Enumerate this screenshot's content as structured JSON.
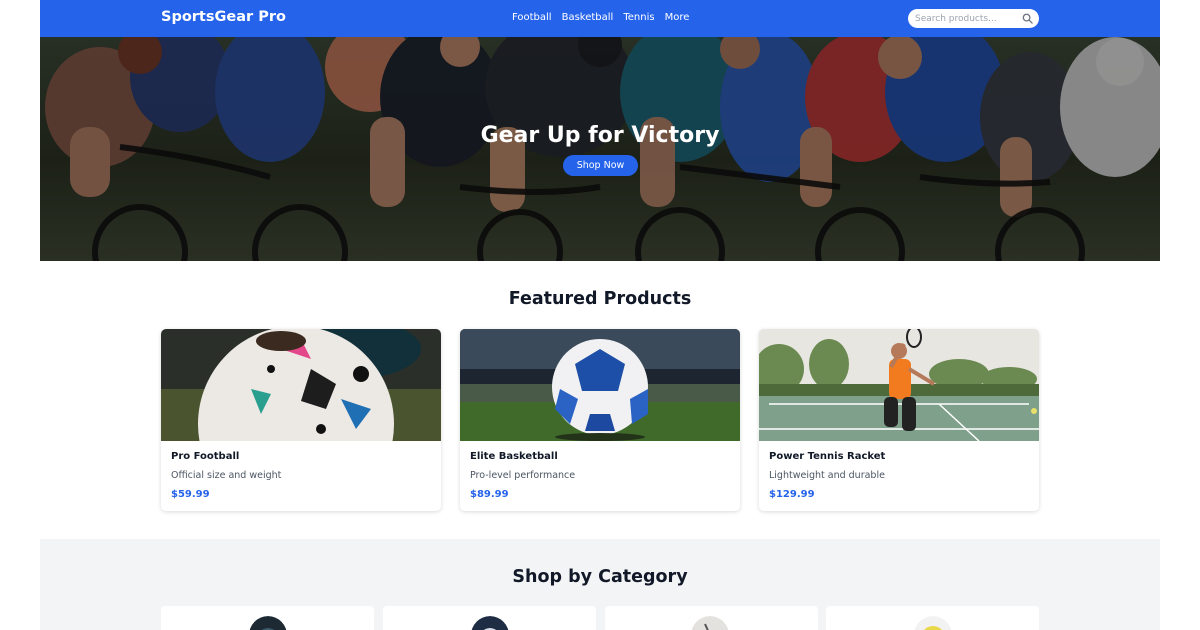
{
  "nav": {
    "brand": "SportsGear Pro",
    "links": [
      "Football",
      "Basketball",
      "Tennis",
      "More"
    ],
    "search_placeholder": "Search products..."
  },
  "hero": {
    "title": "Gear Up for Victory",
    "cta_label": "Shop Now"
  },
  "featured": {
    "title": "Featured Products",
    "products": [
      {
        "name": "Pro Football",
        "description": "Official size and weight",
        "price": "$59.99"
      },
      {
        "name": "Elite Basketball",
        "description": "Pro-level performance",
        "price": "$89.99"
      },
      {
        "name": "Power Tennis Racket",
        "description": "Lightweight and durable",
        "price": "$129.99"
      }
    ]
  },
  "categories": {
    "title": "Shop by Category"
  },
  "colors": {
    "primary": "#2563eb",
    "section_bg": "#f3f4f6",
    "price": "#2563eb"
  }
}
